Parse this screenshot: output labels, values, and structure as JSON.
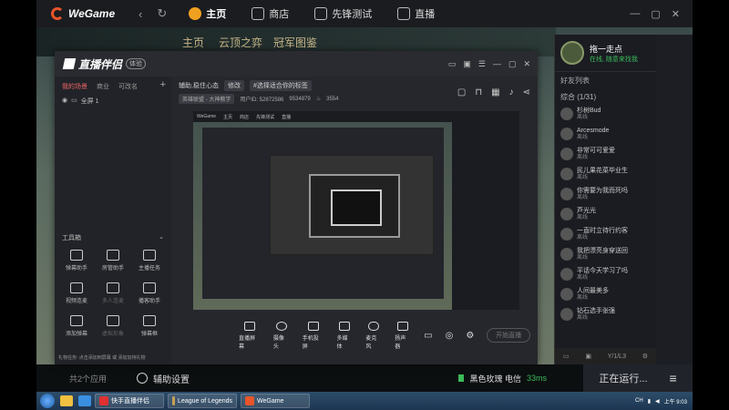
{
  "wegame": {
    "logo": "WeGame",
    "back_icon": "‹",
    "refresh_icon": "↻",
    "tabs": [
      {
        "label": "主页",
        "icon": "home-game-icon",
        "active": true
      },
      {
        "label": "商店",
        "icon": "store-icon"
      },
      {
        "label": "先锋测试",
        "icon": "test-icon"
      },
      {
        "label": "直播",
        "icon": "live-icon"
      }
    ],
    "window_buttons": [
      "—",
      "▢",
      "✕"
    ]
  },
  "game": {
    "top_text": [
      "主页",
      "云顶之弈",
      "冠军图鉴"
    ],
    "count": "共2个应用",
    "help_label": "辅助设置",
    "server": "黑色玫瑰 电信",
    "ping": "33ms",
    "status_button": "正在运行...",
    "menu_icon": "≡"
  },
  "friends": {
    "username": "拖一走点",
    "status": "在线, 随意来找我",
    "tab": "好友列表",
    "group": "综合 (1/31)",
    "items": [
      {
        "name": "杉树Bud",
        "status": "离线"
      },
      {
        "name": "Arcesmode",
        "status": "离线"
      },
      {
        "name": "非常可可爱爱",
        "status": "离线"
      },
      {
        "name": "民儿果花菜毕业生",
        "status": "离线"
      },
      {
        "name": "你需要为我而死吗",
        "status": "离线"
      },
      {
        "name": "芦光光",
        "status": "离线"
      },
      {
        "name": "一直时立待行约客",
        "status": "离线"
      },
      {
        "name": "我把漂亮身穿送回",
        "status": "离线"
      },
      {
        "name": "平话今天学习了吗",
        "status": "离线"
      },
      {
        "name": "人间最美多",
        "status": "离线"
      },
      {
        "name": "钻石选手张强",
        "status": "离线"
      }
    ],
    "bottom": [
      "Y/1/L3"
    ]
  },
  "live": {
    "app_name": "直播伴侣",
    "version": "体验",
    "left_tabs": [
      "我的场景",
      "商业",
      "可改名"
    ],
    "active_tab": "我的场景",
    "scene": "全屏 1",
    "tools_label": "工具箱",
    "tools": [
      {
        "label": "弹幕助手",
        "dim": false
      },
      {
        "label": "房管助手",
        "dim": false
      },
      {
        "label": "主播任务",
        "dim": false
      },
      {
        "label": "视频连麦",
        "dim": false
      },
      {
        "label": "多人连麦",
        "dim": true
      },
      {
        "label": "播客助手",
        "dim": false
      },
      {
        "label": "添加弹幕",
        "dim": false
      },
      {
        "label": "虚拟形象",
        "dim": true
      },
      {
        "label": "弹幕框",
        "dim": false
      }
    ],
    "notice": "礼物任务: 点击添加到屏幕 或 添加加持礼物",
    "room_title": "辅助,稳住心态",
    "edit_label": "修改",
    "tag": "#选择适合你的标签",
    "game_tag": "英雄联盟 - 大神教学",
    "uid": "用户ID: 52872586",
    "fans": "9534879",
    "online": "3554",
    "bottom_buttons": [
      "直播屏幕",
      "摄像头",
      "手机投屏",
      "多媒体",
      "麦克风",
      "扬声器"
    ],
    "start_label": "开始直播"
  },
  "preview": {
    "bar_items": [
      "WeGame",
      "主页",
      "商店",
      "先锋测试",
      "直播"
    ]
  },
  "taskbar": {
    "items": [
      {
        "label": "快手直播伴侣",
        "color": "#e03030"
      },
      {
        "label": "League of Legends",
        "color": "#c9a050"
      },
      {
        "label": "WeGame",
        "color": "#e8552a"
      }
    ],
    "time": "上午 9:03",
    "lang": "CH"
  },
  "colors": {
    "accent": "#e8552a",
    "online": "#3dbb5a"
  }
}
